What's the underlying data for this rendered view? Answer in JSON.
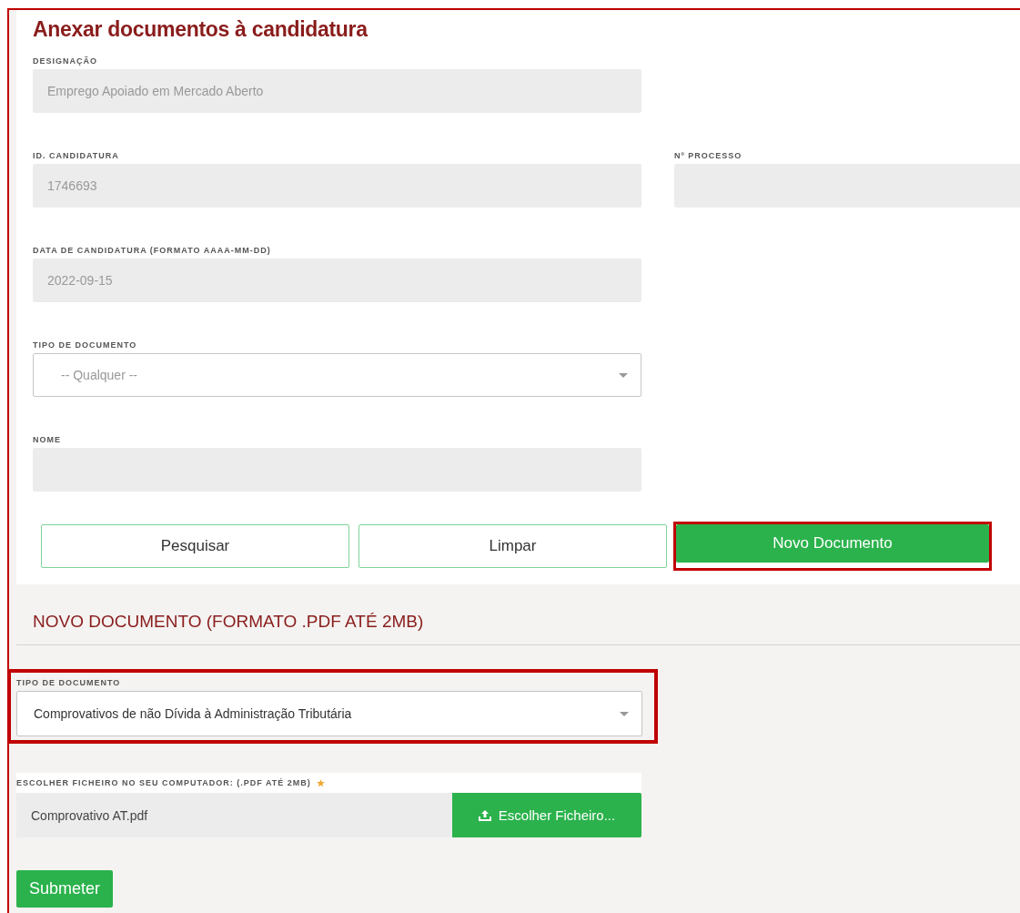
{
  "search_form": {
    "title": "Anexar documentos à candidatura",
    "rows": [
      [
        {
          "label": "DESIGNAÇÃO",
          "kind": "input",
          "value": "Emprego Apoiado em Mercado Aberto"
        }
      ],
      [
        {
          "label": "ID. CANDIDATURA",
          "kind": "input",
          "value": "1746693"
        },
        {
          "label": "Nº PROCESSO",
          "kind": "input"
        }
      ],
      [
        {
          "label": "DATA DE CANDIDATURA (FORMATO AAAA-MM-DD)",
          "kind": "input",
          "value": "2022-09-15"
        }
      ],
      [
        {
          "label": "TIPO DE DOCUMENTO",
          "kind": "select",
          "value": "-- Qualquer --"
        }
      ],
      [
        {
          "label": "NOME",
          "kind": "input"
        }
      ]
    ],
    "buttons": [
      {
        "label": "Pesquisar",
        "kind": "outline",
        "highlighted": false
      },
      {
        "label": "Limpar",
        "kind": "outline",
        "highlighted": false
      },
      {
        "label": "Novo Documento",
        "kind": "primary",
        "highlighted": true
      }
    ]
  },
  "new_document": {
    "title": "NOVO DOCUMENTO (FORMATO .PDF ATÉ 2MB)",
    "document_type": {
      "label": "TIPO DE DOCUMENTO",
      "value": "Comprovativos de não Dívida à Administração Tributária",
      "highlighted": true
    },
    "file": {
      "label": "ESCOLHER FICHEIRO NO SEU COMPUTADOR: (.PDF ATÉ 2MB)",
      "required": true,
      "value": "Comprovativo AT.pdf",
      "button": "Escolher Ficheiro..."
    },
    "submit": "Submeter"
  }
}
